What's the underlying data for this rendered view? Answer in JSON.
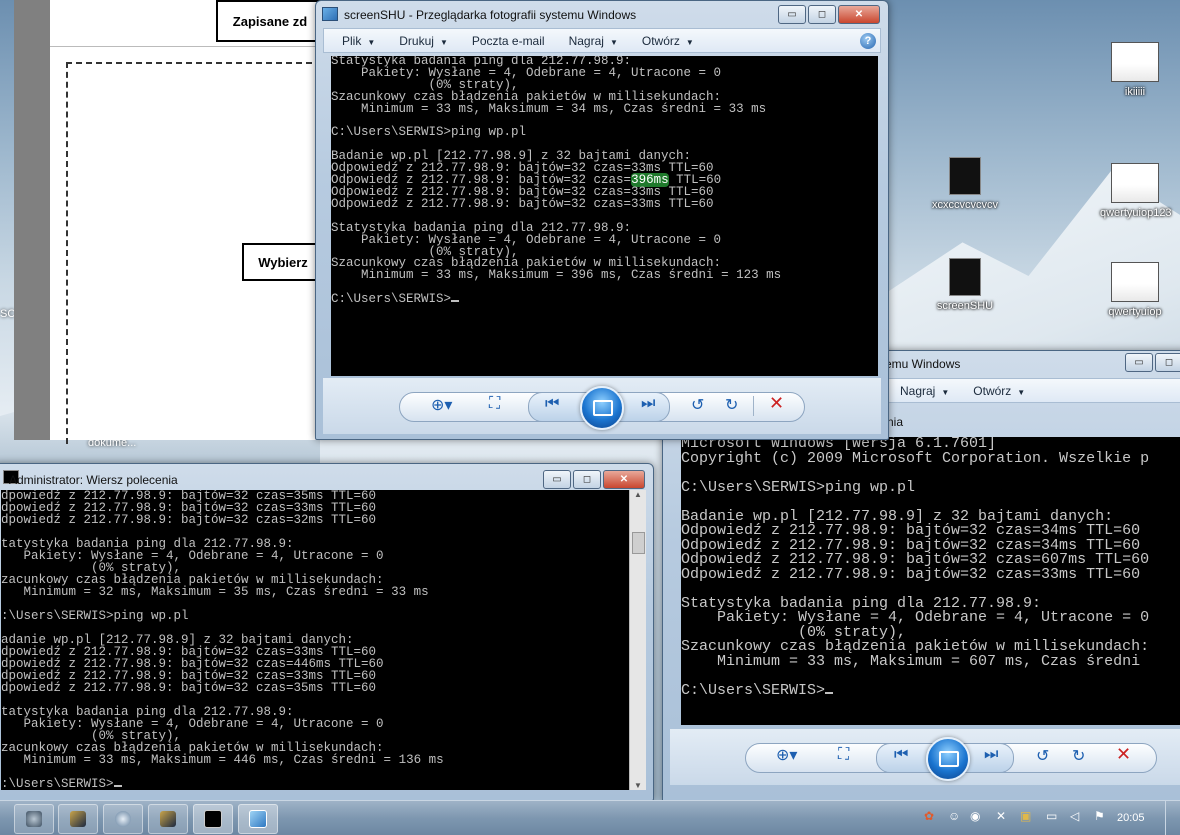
{
  "desktop": {
    "icons": [
      {
        "label": "ikiiiii",
        "thumb": "white"
      },
      {
        "label": "xcxccvcvcvcv",
        "thumb": "black"
      },
      {
        "label": "qwertyuiop123",
        "thumb": "white"
      },
      {
        "label": "screenSHU",
        "thumb": "black"
      },
      {
        "label": "qwertyuiop",
        "thumb": "white"
      }
    ],
    "partial_labels": {
      "left_sc": "SC",
      "doc_label": "dokume..."
    }
  },
  "doc": {
    "button1": "Zapisane zd",
    "button2": "Wybierz"
  },
  "viewer_top": {
    "title": "screenSHU - Przeglądarka fotografii systemu Windows",
    "caption_buttons": {
      "min": "▭",
      "max": "◻",
      "close": "✕"
    },
    "menu": [
      {
        "label": "Plik",
        "arrow": "▼"
      },
      {
        "label": "Drukuj",
        "arrow": "▼"
      },
      {
        "label": "Poczta e-mail",
        "arrow": ""
      },
      {
        "label": "Nagraj",
        "arrow": "▼"
      },
      {
        "label": "Otwórz",
        "arrow": "▼"
      }
    ],
    "help": "?",
    "console": [
      "Statystyka badania ping dla 212.77.98.9:",
      "    Pakiety: Wysłane = 4, Odebrane = 4, Utracone = 0",
      "             (0% straty),",
      "Szacunkowy czas błądzenia pakietów w millisekundach:",
      "    Minimum = 33 ms, Maksimum = 34 ms, Czas średni = 33 ms",
      "",
      "C:\\Users\\SERWIS>ping wp.pl",
      "",
      "Badanie wp.pl [212.77.98.9] z 32 bajtami danych:",
      "Odpowiedź z 212.77.98.9: bajtów=32 czas=33ms TTL=60",
      "Odpowiedź z 212.77.98.9: bajtów=32 czas=396ms TTL=60",
      "Odpowiedź z 212.77.98.9: bajtów=32 czas=33ms TTL=60",
      "Odpowiedź z 212.77.98.9: bajtów=32 czas=33ms TTL=60",
      "",
      "Statystyka badania ping dla 212.77.98.9:",
      "    Pakiety: Wysłane = 4, Odebrane = 4, Utracone = 0",
      "             (0% straty),",
      "Szacunkowy czas błądzenia pakietów w millisekundach:",
      "    Minimum = 33 ms, Maksimum = 396 ms, Czas średni = 123 ms",
      "",
      "C:\\Users\\SERWIS>"
    ],
    "highlight_line": 10,
    "highlight_text": "396ms"
  },
  "viewer_right": {
    "title": "emu Windows",
    "menu": [
      {
        "label": "Nagraj",
        "arrow": "▼"
      },
      {
        "label": "Otwórz",
        "arrow": "▼"
      }
    ],
    "partial": "nia",
    "console": [
      "Microsoft Windows [Wersja 6.1.7601]",
      "Copyright (c) 2009 Microsoft Corporation. Wszelkie p",
      "",
      "C:\\Users\\SERWIS>ping wp.pl",
      "",
      "Badanie wp.pl [212.77.98.9] z 32 bajtami danych:",
      "Odpowiedź z 212.77.98.9: bajtów=32 czas=34ms TTL=60",
      "Odpowiedź z 212.77.98.9: bajtów=32 czas=34ms TTL=60",
      "Odpowiedź z 212.77.98.9: bajtów=32 czas=607ms TTL=60",
      "Odpowiedź z 212.77.98.9: bajtów=32 czas=33ms TTL=60",
      "",
      "Statystyka badania ping dla 212.77.98.9:",
      "    Pakiety: Wysłane = 4, Odebrane = 4, Utracone = 0",
      "             (0% straty),",
      "Szacunkowy czas błądzenia pakietów w millisekundach:",
      "    Minimum = 33 ms, Maksimum = 607 ms, Czas średni",
      "",
      "C:\\Users\\SERWIS>"
    ]
  },
  "cmd_window": {
    "title": "Administrator: Wiersz polecenia",
    "console": [
      "dpowiedź z 212.77.98.9: bajtów=32 czas=35ms TTL=60",
      "dpowiedź z 212.77.98.9: bajtów=32 czas=33ms TTL=60",
      "dpowiedź z 212.77.98.9: bajtów=32 czas=32ms TTL=60",
      "",
      "tatystyka badania ping dla 212.77.98.9:",
      "   Pakiety: Wysłane = 4, Odebrane = 4, Utracone = 0",
      "            (0% straty),",
      "zacunkowy czas błądzenia pakietów w millisekundach:",
      "   Minimum = 32 ms, Maksimum = 35 ms, Czas średni = 33 ms",
      "",
      ":\\Users\\SERWIS>ping wp.pl",
      "",
      "adanie wp.pl [212.77.98.9] z 32 bajtami danych:",
      "dpowiedź z 212.77.98.9: bajtów=32 czas=33ms TTL=60",
      "dpowiedź z 212.77.98.9: bajtów=32 czas=446ms TTL=60",
      "dpowiedź z 212.77.98.9: bajtów=32 czas=33ms TTL=60",
      "dpowiedź z 212.77.98.9: bajtów=32 czas=35ms TTL=60",
      "",
      "tatystyka badania ping dla 212.77.98.9:",
      "   Pakiety: Wysłane = 4, Odebrane = 4, Utracone = 0",
      "            (0% straty),",
      "zacunkowy czas błądzenia pakietów w millisekundach:",
      "   Minimum = 33 ms, Maksimum = 446 ms, Czas średni = 136 ms",
      "",
      ":\\Users\\SERWIS>"
    ]
  },
  "taskbar": {
    "clock": "20:05",
    "buttons": [
      "shield-app",
      "league-app",
      "spiral-app",
      "league-app-2",
      "cmd-app",
      "photo-viewer-app"
    ],
    "tray": [
      "tray-app",
      "tray-steam",
      "tray-steam2",
      "tray-network-off",
      "tray-league",
      "tray-device",
      "tray-speaker",
      "tray-flag"
    ]
  },
  "colors": {
    "highlight": "#1f7a2c",
    "console_text": "#c0c0c0",
    "close_button": "#c9462e",
    "nav_icon": "#1d5fb0",
    "delete_icon": "#cc2222"
  }
}
